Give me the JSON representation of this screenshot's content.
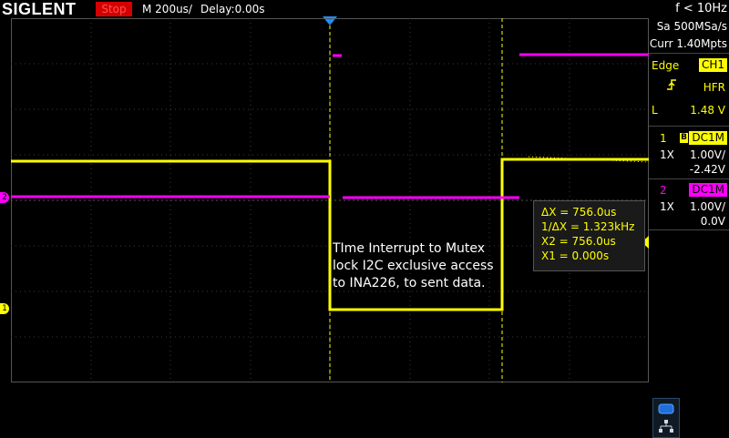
{
  "header": {
    "brand": "SIGLENT",
    "run_state": "Stop",
    "timebase": "M 200us/",
    "delay": "Delay:0.00s",
    "trigger_freq": "f < 10Hz"
  },
  "acquisition": {
    "sample_rate": "Sa 500MSa/s",
    "memory": "Curr 1.40Mpts"
  },
  "trigger": {
    "mode": "Edge",
    "source": "CH1",
    "coupling": "HFR",
    "level_label": "L",
    "level": "1.48 V"
  },
  "channel1": {
    "number": "1",
    "coupling": "DC1M",
    "probe": "1X",
    "scale": "1.00V/",
    "offset": "-2.42V"
  },
  "channel2": {
    "number": "2",
    "coupling": "DC1M",
    "probe": "1X",
    "scale": "1.00V/",
    "offset": "0.0V"
  },
  "markers": {
    "ch1": "1",
    "ch2": "2"
  },
  "measurement": {
    "delta_x": "ΔX = 756.0us",
    "inv_delta_x": "1/ΔX = 1.323kHz",
    "x2": "X2 = 756.0us",
    "x1": "X1 = 0.000s"
  },
  "annotation": {
    "line1": "TIme Interrupt to Mutex",
    "line2": "lock I2C exclusive access",
    "line3": "to INA226, to sent data."
  },
  "colors": {
    "ch1": "#ffff00",
    "ch2": "#ff00ff",
    "cursor": "#ffff00",
    "trigger_marker": "#1e90ff",
    "run_stop_bg": "#d40000"
  },
  "icons": [
    "trigger-position-icon",
    "rising-edge-icon",
    "bandwidth-limit-icon",
    "usb-icon",
    "network-icon"
  ]
}
